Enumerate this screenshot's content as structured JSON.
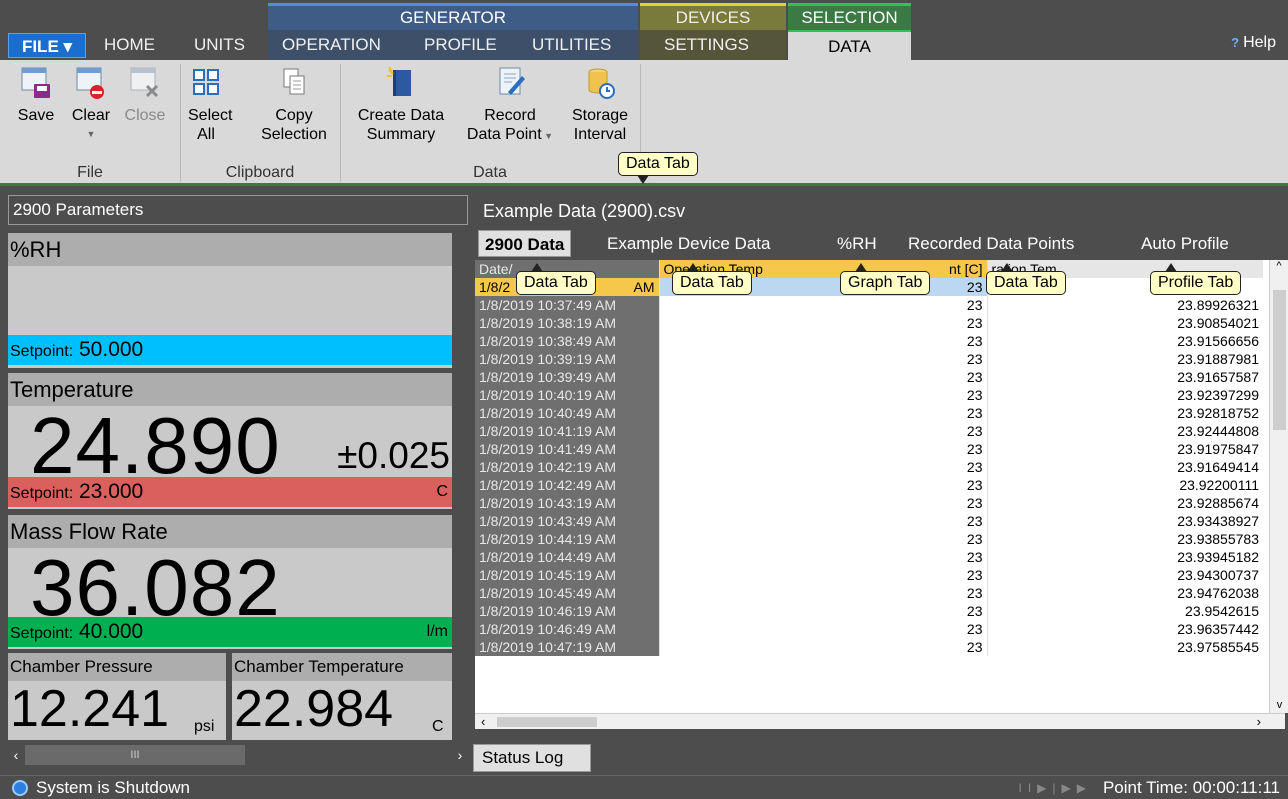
{
  "topbar": {
    "file_label": "FILE ▾",
    "tabs": [
      "HOME",
      "UNITS",
      "OPERATION",
      "PROFILE",
      "UTILITIES",
      "SETTINGS",
      "DATA"
    ],
    "groups": {
      "generator": "GENERATOR",
      "devices": "DEVICES",
      "selection": "SELECTION"
    },
    "help": "Help"
  },
  "ribbon": {
    "file_group": {
      "label": "File",
      "save": "Save",
      "clear": "Clear",
      "close": "Close"
    },
    "clipboard_group": {
      "label": "Clipboard",
      "select_all_1": "Select",
      "select_all_2": "All",
      "copy_1": "Copy",
      "copy_2": "Selection"
    },
    "data_group": {
      "label": "Data",
      "create_1": "Create Data",
      "create_2": "Summary",
      "record_1": "Record",
      "record_2": "Data Point",
      "storage_1": "Storage",
      "storage_2": "Interval"
    }
  },
  "callouts": {
    "ribbon": "Data Tab",
    "tab1": "Data Tab",
    "tab2": "Data Tab",
    "tab3": "Graph Tab",
    "tab4": "Data Tab",
    "tab5": "Profile Tab"
  },
  "left": {
    "header": "2900 Parameters",
    "rh": {
      "title": "%RH",
      "setpoint_label": "Setpoint:",
      "setpoint": "50.000"
    },
    "temperature": {
      "title": "Temperature",
      "value": "24.890",
      "tolerance": "±0.025",
      "setpoint_label": "Setpoint:",
      "setpoint": "23.000",
      "unit": "C"
    },
    "massflow": {
      "title": "Mass Flow Rate",
      "value": "36.082",
      "setpoint_label": "Setpoint:",
      "setpoint": "40.000",
      "unit": "l/m"
    },
    "pressure": {
      "title": "Chamber Pressure",
      "value": "12.241",
      "unit": "psi"
    },
    "chamber_temp": {
      "title": "Chamber Temperature",
      "value": "22.984",
      "unit": "C"
    },
    "scroll_thumb": "III"
  },
  "right": {
    "filename": "Example Data (2900).csv",
    "tabs": [
      "2900 Data",
      "Example Device Data",
      "%RH",
      "Recorded Data Points",
      "Auto Profile"
    ],
    "columns": [
      "Date/",
      "Operation Temp",
      "nt [C]",
      "ration Tem"
    ],
    "rows": [
      {
        "t": "1/8/2",
        "tsuffix": "AM",
        "a": "23",
        "b": ""
      },
      {
        "t": "1/8/2019 10:37:49 AM",
        "a": "23",
        "b": "23.89926321"
      },
      {
        "t": "1/8/2019 10:38:19 AM",
        "a": "23",
        "b": "23.90854021"
      },
      {
        "t": "1/8/2019 10:38:49 AM",
        "a": "23",
        "b": "23.91566656"
      },
      {
        "t": "1/8/2019 10:39:19 AM",
        "a": "23",
        "b": "23.91887981"
      },
      {
        "t": "1/8/2019 10:39:49 AM",
        "a": "23",
        "b": "23.91657587"
      },
      {
        "t": "1/8/2019 10:40:19 AM",
        "a": "23",
        "b": "23.92397299"
      },
      {
        "t": "1/8/2019 10:40:49 AM",
        "a": "23",
        "b": "23.92818752"
      },
      {
        "t": "1/8/2019 10:41:19 AM",
        "a": "23",
        "b": "23.92444808"
      },
      {
        "t": "1/8/2019 10:41:49 AM",
        "a": "23",
        "b": "23.91975847"
      },
      {
        "t": "1/8/2019 10:42:19 AM",
        "a": "23",
        "b": "23.91649414"
      },
      {
        "t": "1/8/2019 10:42:49 AM",
        "a": "23",
        "b": "23.92200111"
      },
      {
        "t": "1/8/2019 10:43:19 AM",
        "a": "23",
        "b": "23.92885674"
      },
      {
        "t": "1/8/2019 10:43:49 AM",
        "a": "23",
        "b": "23.93438927"
      },
      {
        "t": "1/8/2019 10:44:19 AM",
        "a": "23",
        "b": "23.93855783"
      },
      {
        "t": "1/8/2019 10:44:49 AM",
        "a": "23",
        "b": "23.93945182"
      },
      {
        "t": "1/8/2019 10:45:19 AM",
        "a": "23",
        "b": "23.94300737"
      },
      {
        "t": "1/8/2019 10:45:49 AM",
        "a": "23",
        "b": "23.94762038"
      },
      {
        "t": "1/8/2019 10:46:19 AM",
        "a": "23",
        "b": "23.9542615"
      },
      {
        "t": "1/8/2019 10:46:49 AM",
        "a": "23",
        "b": "23.96357442"
      },
      {
        "t": "1/8/2019 10:47:19 AM",
        "a": "23",
        "b": "23.97585545"
      }
    ],
    "status_log_tab": "Status Log"
  },
  "statusbar": {
    "status": "System is Shutdown",
    "point_time": "Point Time: 00:00:11:11"
  },
  "colors": {
    "rh_setpoint": "#00bfff",
    "temp_setpoint": "#d9605c",
    "flow_setpoint": "#00b050",
    "accent": "#1a6fce"
  }
}
